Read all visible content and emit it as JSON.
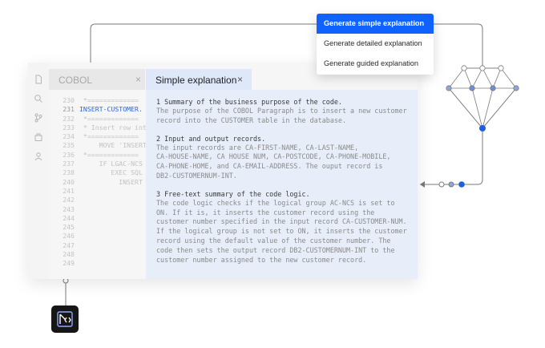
{
  "editor": {
    "tab_label": "COBOL",
    "tab_close": "×",
    "code_lines": [
      {
        "num": "230",
        "text": " *=============",
        "active": false
      },
      {
        "num": "231",
        "text": "INSERT-CUSTOMER.",
        "active": true
      },
      {
        "num": "232",
        "text": " *=============",
        "active": false
      },
      {
        "num": "233",
        "text": " * Insert row into",
        "active": false
      },
      {
        "num": "234",
        "text": " *=============",
        "active": false
      },
      {
        "num": "235",
        "text": "     MOVE 'INSERT",
        "active": false
      },
      {
        "num": "236",
        "text": " *=============",
        "active": false
      },
      {
        "num": "237",
        "text": "     IF LGAC-NCS",
        "active": false
      },
      {
        "num": "238",
        "text": "        EXEC SQL",
        "active": false
      },
      {
        "num": "240",
        "text": "          INSERT",
        "active": false
      },
      {
        "num": "241",
        "text": "",
        "active": false
      },
      {
        "num": "242",
        "text": "",
        "active": false
      },
      {
        "num": "243",
        "text": "",
        "active": false
      },
      {
        "num": "244",
        "text": "",
        "active": false
      },
      {
        "num": "245",
        "text": "",
        "active": false
      },
      {
        "num": "246",
        "text": "",
        "active": false
      },
      {
        "num": "247",
        "text": "",
        "active": false
      },
      {
        "num": "248",
        "text": "",
        "active": false
      },
      {
        "num": "249",
        "text": "",
        "active": false
      }
    ]
  },
  "panel": {
    "tab_label": "Simple explanation",
    "tab_close": "×",
    "sections": [
      {
        "title": "1 Summary of the business purpose of the code.",
        "body": "The purpose of the COBOL Paragraph is to insert a new customer\nrecord into the CUSTOMER table in the database."
      },
      {
        "title": "2 Input and output records.",
        "body": "The input records are CA-FIRST-NAME, CA-LAST-NAME,\nCA-HOUSE-NAME, CA HOUSE NUM, CA-POSTCODE, CA-PHONE-MOBILE,\nCA-PHONE-HOME, and CA-EMAIL-ADDRESS. The ouput record is\nDB2-CUSTOMERNUM-INT."
      },
      {
        "title": "3 Free-text summary of the code logic.",
        "body": "The code logic checks if the logical group AC-NCS is set to\nON. If it is, it inserts the customer record using the\ncustomer number specified in the input record CA-CUSTOMER-NUM.\nIf the logical group is not set to ON, it inserts the customer\nrecord using the default value of the customer number. The\ncode then sets the output record DB2-CUSTOMERNUM-INT to the\ncustomer number assigned to the new customer record."
      }
    ]
  },
  "menu": {
    "items": [
      {
        "label": "Generate simple explanation",
        "selected": true
      },
      {
        "label": "Generate detailed explanation",
        "selected": false
      },
      {
        "label": "Generate guided explanation",
        "selected": false
      }
    ]
  },
  "colors": {
    "accent": "#0f62fe",
    "code_highlight": "#2c66d8",
    "panel_bg": "#e7eef9",
    "connector": "#7a7a7a",
    "node_fill": "#6b8ed6",
    "node_active": "#1f5fd9"
  },
  "icons": {
    "sidebar": [
      "file-icon",
      "search-icon",
      "branch-icon",
      "package-icon",
      "user-icon"
    ],
    "logo": "watsonx-code-assistant-logo"
  }
}
